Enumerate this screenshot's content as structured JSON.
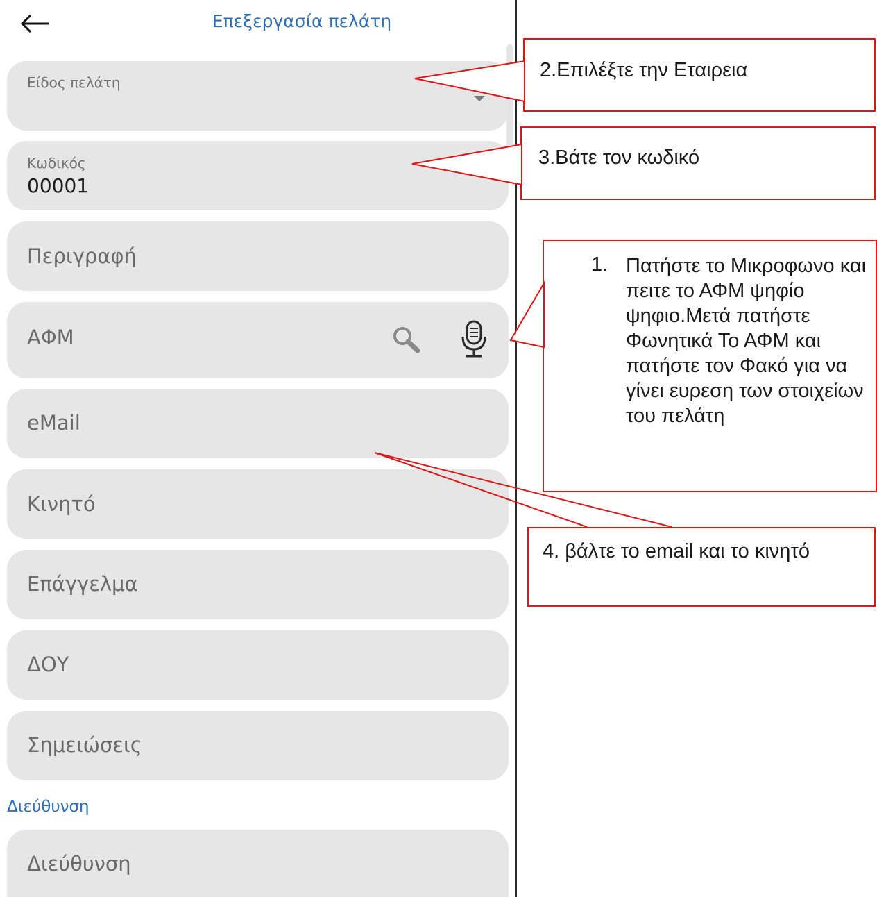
{
  "header": {
    "title": "Επεξεργασία πελάτη"
  },
  "form": {
    "customer_type": {
      "label": "Είδος πελάτη",
      "value": ""
    },
    "code": {
      "label": "Κωδικός",
      "value": "00001"
    },
    "description": {
      "placeholder": "Περιγραφή"
    },
    "afm": {
      "placeholder": "ΑΦΜ"
    },
    "email": {
      "placeholder": "eMail"
    },
    "mobile": {
      "placeholder": "Κινητό"
    },
    "profession": {
      "placeholder": "Επάγγελμα"
    },
    "doy": {
      "placeholder": "ΔΟΥ"
    },
    "notes": {
      "placeholder": "Σημειώσεις"
    },
    "address_section": {
      "label": "Διεύθυνση"
    },
    "address": {
      "placeholder": "Διεύθυνση"
    }
  },
  "icons": {
    "back": "arrow-left-icon",
    "dropdown": "caret-down-icon",
    "search": "search-icon",
    "mic": "microphone-icon"
  },
  "annotations": {
    "step1": {
      "number": "1.",
      "text": "Πατήστε το Μικροφωνο και πειτε το ΑΦΜ ψηφίο ψηφιο.Μετά πατήστε Φωνητικά Το ΑΦΜ και πατήστε τον Φακό για να γίνει ευρεση των στοιχείων του πελάτη"
    },
    "step2": {
      "text": "2.Επιλέξτε την Εταιρεια"
    },
    "step3": {
      "text": "3.Βάτε τον κωδικό"
    },
    "step4": {
      "text": "4. βάλτε το email και το κινητό"
    }
  },
  "colors": {
    "accent": "#2f6fb8",
    "field_bg": "#e6e6e6",
    "callout_border": "#e01515"
  }
}
